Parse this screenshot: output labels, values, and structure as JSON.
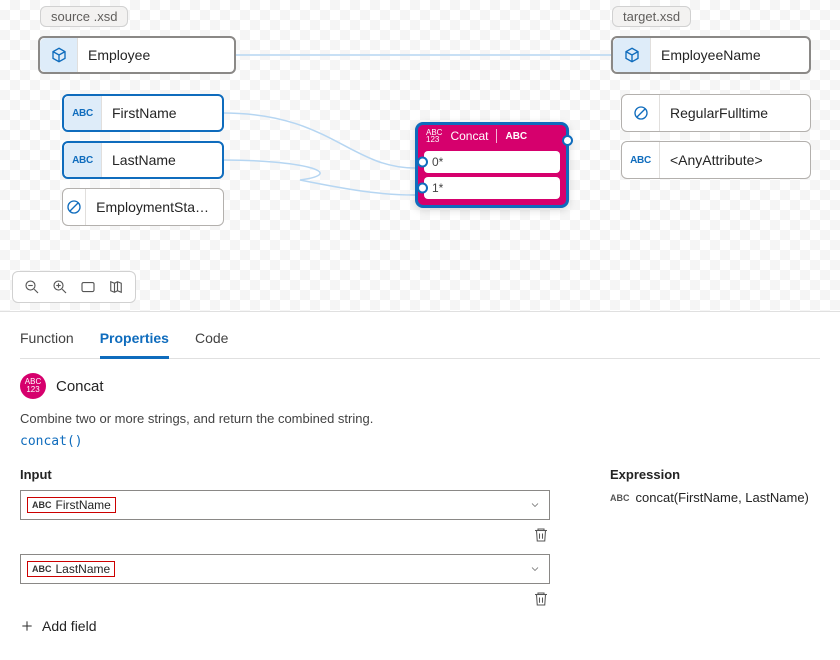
{
  "source": {
    "label": "source .xsd",
    "rootNode": "Employee",
    "fields": [
      {
        "name": "FirstName",
        "icon": "abc",
        "selected": true
      },
      {
        "name": "LastName",
        "icon": "abc",
        "selected": true
      },
      {
        "name": "EmploymentSta…",
        "icon": "ban",
        "selected": false
      }
    ]
  },
  "target": {
    "label": "target.xsd",
    "rootNode": "EmployeeName",
    "fields": [
      {
        "name": "RegularFulltime",
        "icon": "ban"
      },
      {
        "name": "<AnyAttribute>",
        "icon": "abc"
      }
    ]
  },
  "functionNode": {
    "title": "Concat",
    "inputs": [
      "0*",
      "1*"
    ]
  },
  "tabs": [
    "Function",
    "Properties",
    "Code"
  ],
  "activeTab": "Properties",
  "properties": {
    "functionName": "Concat",
    "description": "Combine two or more strings, and return the combined string.",
    "signature": "concat()",
    "inputHeading": "Input",
    "inputs": [
      "FirstName",
      "LastName"
    ],
    "addFieldLabel": "Add field",
    "expressionHeading": "Expression",
    "expression": "concat(FirstName, LastName)"
  }
}
